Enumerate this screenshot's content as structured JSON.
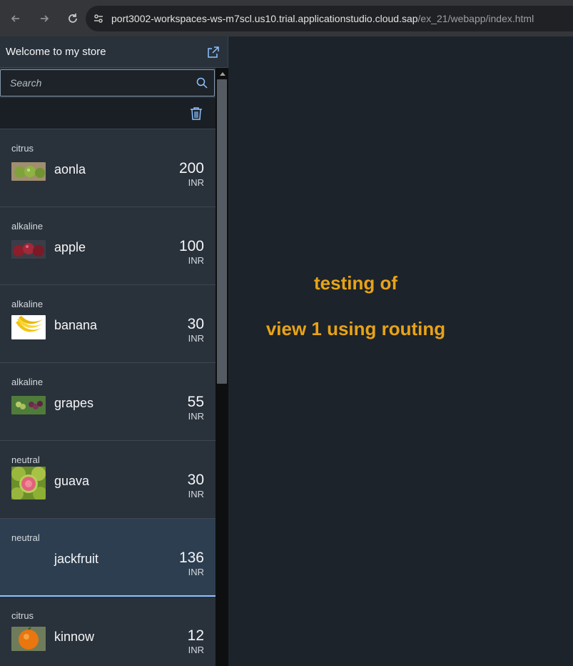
{
  "browser": {
    "url_main": "port3002-workspaces-ws-m7scl.us10.trial.applicationstudio.cloud.sap",
    "url_path": "/ex_21/webapp/index.html"
  },
  "master": {
    "title": "Welcome to my store",
    "search_placeholder": "Search",
    "items": [
      {
        "category": "citrus",
        "name": "aonla",
        "price": "200",
        "unit": "INR",
        "thumb": "aonla-image"
      },
      {
        "category": "alkaline",
        "name": "apple",
        "price": "100",
        "unit": "INR",
        "thumb": "apple-image"
      },
      {
        "category": "alkaline",
        "name": "banana",
        "price": "30",
        "unit": "INR",
        "thumb": "banana-image"
      },
      {
        "category": "alkaline",
        "name": "grapes",
        "price": "55",
        "unit": "INR",
        "thumb": "grapes-image"
      },
      {
        "category": "neutral",
        "name": "guava",
        "price": "30",
        "unit": "INR",
        "thumb": "guava-image"
      },
      {
        "category": "neutral",
        "name": "jackfruit",
        "price": "136",
        "unit": "INR",
        "thumb": ""
      },
      {
        "category": "citrus",
        "name": "kinnow",
        "price": "12",
        "unit": "INR",
        "thumb": "kinnow-image"
      }
    ]
  },
  "detail": {
    "line1": "testing of",
    "line2": "view 1 using routing"
  },
  "colors": {
    "accent": "#8fc3ff",
    "detail_text": "#e8a317",
    "selected_bg": "#2c3e50"
  }
}
